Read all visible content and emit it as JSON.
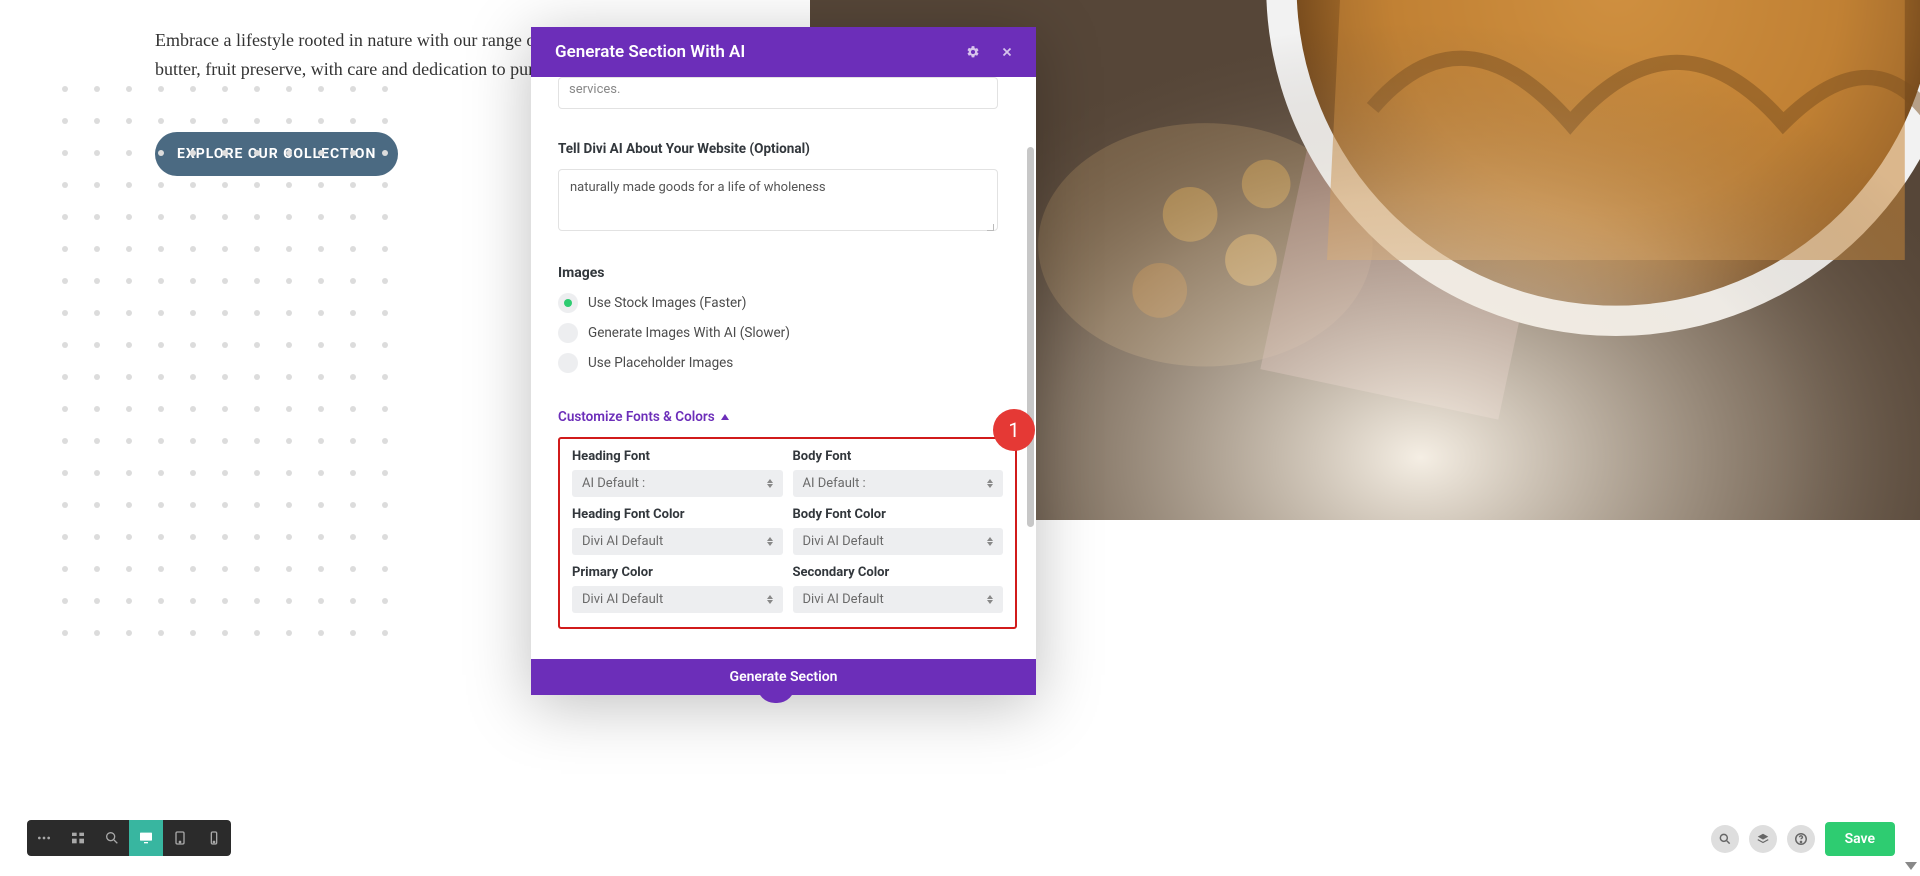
{
  "hero": {
    "text": "Embrace a lifestyle rooted in nature with our range of honey, seeds, nut butter, fruit preserve, with care and dedication to purity.",
    "cta": "EXPLORE OUR COLLECTION"
  },
  "modal": {
    "title": "Generate Section With AI",
    "hidden_textarea": "services.",
    "about_label": "Tell Divi AI About Your Website (Optional)",
    "about_value": "naturally made goods for a life of wholeness",
    "images_heading": "Images",
    "radios": [
      {
        "label": "Use Stock Images (Faster)",
        "selected": true
      },
      {
        "label": "Generate Images With AI (Slower)",
        "selected": false
      },
      {
        "label": "Use Placeholder Images",
        "selected": false
      }
    ],
    "customize_link": "Customize Fonts & Colors",
    "fields": {
      "heading_font": {
        "label": "Heading Font",
        "value": "AI Default :"
      },
      "body_font": {
        "label": "Body Font",
        "value": "AI Default :"
      },
      "heading_font_color": {
        "label": "Heading Font Color",
        "value": "Divi AI Default"
      },
      "body_font_color": {
        "label": "Body Font Color",
        "value": "Divi AI Default"
      },
      "primary_color": {
        "label": "Primary Color",
        "value": "Divi AI Default"
      },
      "secondary_color": {
        "label": "Secondary Color",
        "value": "Divi AI Default"
      }
    },
    "callout_number": "1",
    "generate_button": "Generate Section"
  },
  "bottom_right": {
    "save": "Save"
  }
}
